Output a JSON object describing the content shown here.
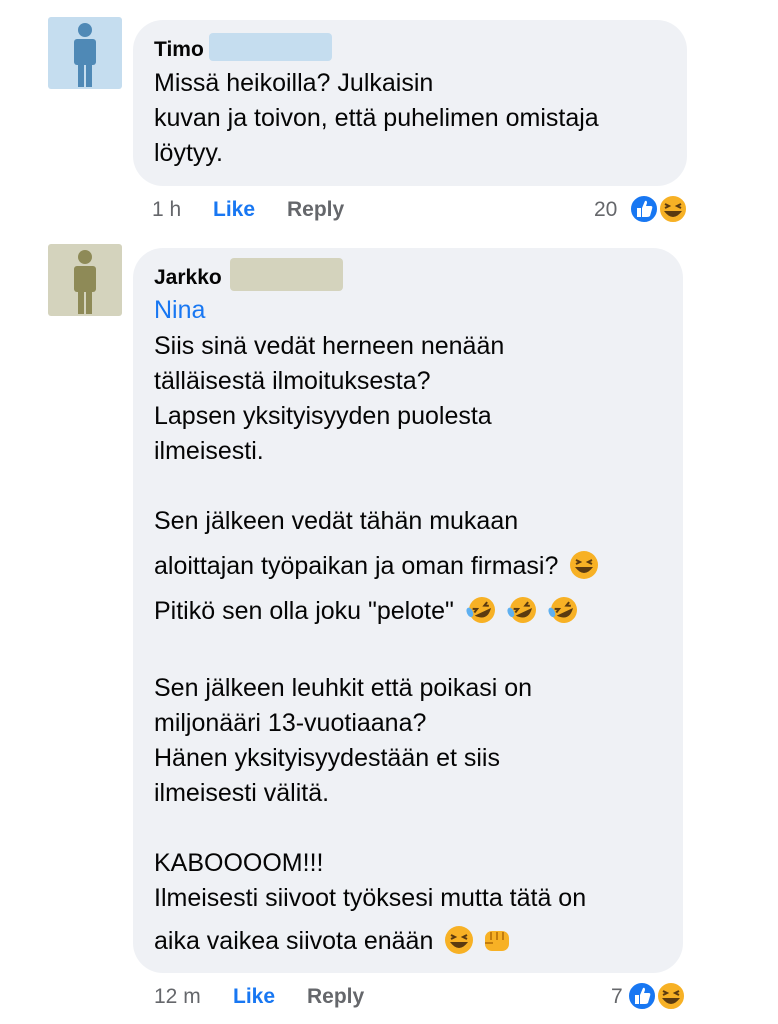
{
  "comments": [
    {
      "author": "Timo",
      "avatar_color": "#c5ddef",
      "avatar_figure_color": "#4f89b6",
      "redact_color": "#c5ddef",
      "tag": "",
      "lines": [
        "Missä heikoilla? Julkaisin",
        "kuvan ja toivon, että puhelimen omistaja",
        "löytyy."
      ],
      "time": "1 h",
      "like_label": "Like",
      "reply_label": "Reply",
      "reaction_count": "20",
      "reactions": [
        "like-icon",
        "laugh-emoji"
      ]
    },
    {
      "author": "Jarkko",
      "avatar_color": "#d4d3bd",
      "avatar_figure_color": "#8e8a57",
      "redact_color": "#d4d3bd",
      "tag": "Nina",
      "lines": [
        "Siis sinä vedät herneen nenään",
        "tälläisestä ilmoituksesta?",
        "Lapsen yksityisyyden puolesta",
        "ilmeisesti.",
        "",
        "Sen jälkeen vedät tähän mukaan",
        "aloittajan työpaikan ja oman firmasi?",
        "Pitikö sen olla joku \"pelote\"",
        "",
        "Sen jälkeen leuhkit että poikasi on",
        "miljonääri 13-vuotiaana?",
        "Hänen yksityisyydestään et siis",
        "ilmeisesti välitä.",
        "",
        "KABOOOOM!!!",
        "Ilmeisesti siivoot työksesi mutta tätä on",
        "aika vaikea siivota enään"
      ],
      "time": "12 m",
      "like_label": "Like",
      "reply_label": "Reply",
      "reaction_count": "7",
      "reactions": [
        "like-icon",
        "laugh-emoji"
      ]
    }
  ],
  "colors": {
    "bubble": "#eff1f5",
    "link_blue": "#1877f2",
    "muted": "#65676b"
  }
}
